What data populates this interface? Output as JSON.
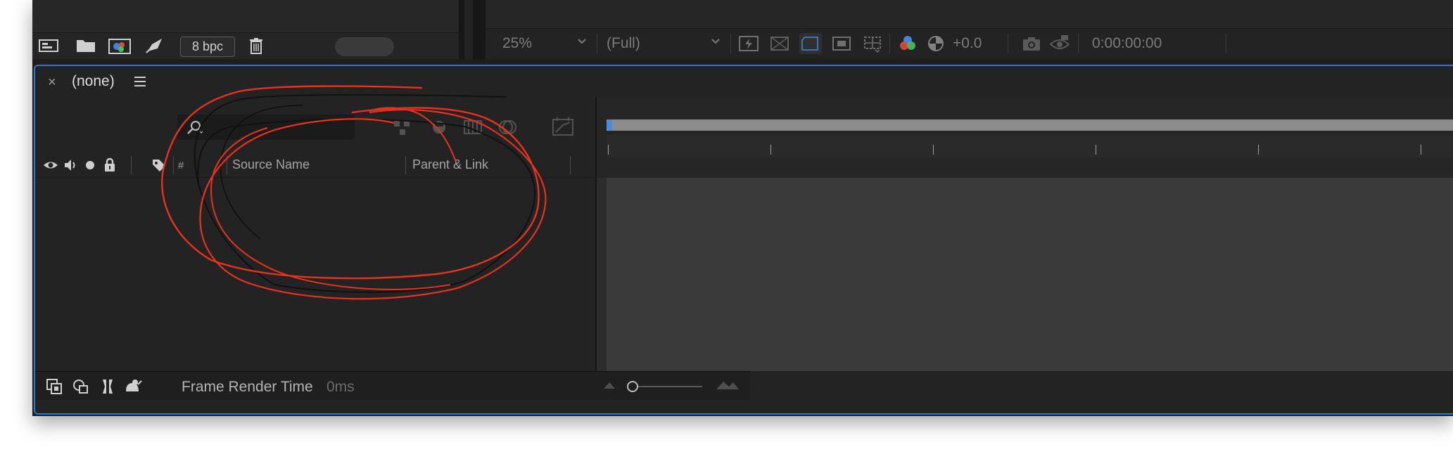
{
  "project_panel": {
    "bpc_label": "8 bpc",
    "icons": [
      "interpret-footage-icon",
      "new-folder-icon",
      "new-composition-icon",
      "rocket-icon",
      "trash-icon"
    ]
  },
  "composition_panel": {
    "zoom_level": "25%",
    "resolution": "(Full)",
    "exposure": "+0.0",
    "timecode": "0:00:00:00"
  },
  "timeline": {
    "tab_title": "(none)",
    "close_symbol": "×",
    "columns": {
      "number": "#",
      "source_name": "Source Name",
      "parent_link": "Parent & Link"
    },
    "frame_render_time_label": "Frame Render Time",
    "frame_render_time_value": "0ms"
  },
  "colors": {
    "accent_blue": "#2f74d0",
    "annotation_red": "#e8321f",
    "annotation_black": "#111111"
  }
}
